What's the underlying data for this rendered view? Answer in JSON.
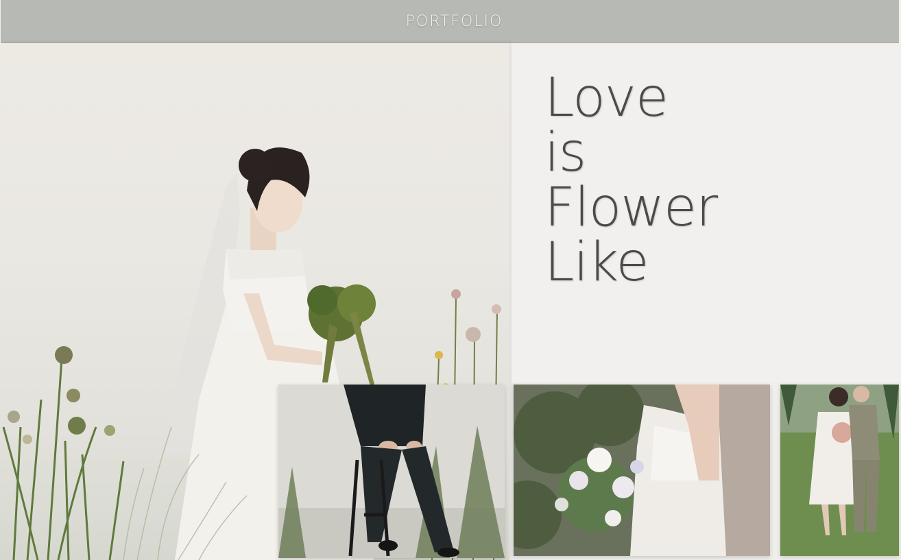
{
  "header": {
    "brand": "PORTFOLIO"
  },
  "headline": {
    "words": [
      "Love",
      "is",
      "Flower",
      "Like"
    ]
  },
  "colors": {
    "header_bg": "#b7b9b4",
    "brand_text": "#f4f4f2",
    "panel_bg": "#f1f0ee",
    "headline_text": "#4a4a48"
  },
  "images": {
    "hero": "bride-with-bouquet-photo",
    "thumbs": [
      "groom-seated-photo",
      "bride-bouquet-closeup-photo",
      "couple-in-field-photo"
    ]
  }
}
